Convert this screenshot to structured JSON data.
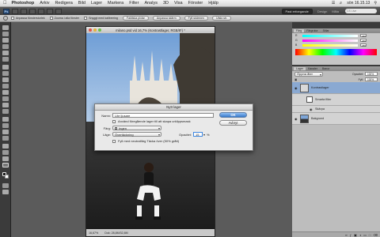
{
  "menubar": {
    "app_name": "Photoshop",
    "items": [
      "Arkiv",
      "Redigera",
      "Bild",
      "Lager",
      "Markera",
      "Filter",
      "Analys",
      "3D",
      "Visa",
      "Fönster",
      "Hjälp"
    ],
    "clock": "sön 16.15.13"
  },
  "appbar": {
    "logo": "Ps",
    "workspace_button": "Past erfoegande",
    "workspace_tabs": [
      "Design",
      "Måla"
    ],
    "search_label": "CS Live"
  },
  "options": {
    "check1": "Anpassa fönsterstorlek",
    "check2": "Zooma i alla fönster",
    "check3": "Snyggt med kalibrering",
    "btn1": "Faktiska pixlar",
    "btn2": "Anpassa skärm",
    "btn3": "Fyll skärmen",
    "btn4": "Utskr.str."
  },
  "document": {
    "title": "milano.psd vid 16,7% (Kontrastlager, RGB/8*) *",
    "zoom": "16,67%",
    "doc_info": "Dok: 28,8M/32,8M"
  },
  "panels": {
    "color_tabs": [
      "Färg",
      "Färgrutor",
      "Stilar"
    ],
    "sliders": [
      {
        "label": "R",
        "value": "255"
      },
      {
        "label": "G",
        "value": "255"
      },
      {
        "label": "B",
        "value": "255"
      }
    ],
    "layers_tabs": [
      "Lager",
      "Kanaler",
      "Banor"
    ],
    "blend_mode": "Öppna åter",
    "opacity_label": "Opacitet:",
    "opacity_value": "100%",
    "fill_label": "Fyll:",
    "fill_value": "100%",
    "layers": [
      {
        "name": "Kontrastlager",
        "selected": true
      },
      {
        "name": "Smarta filter",
        "selected": false
      },
      {
        "name": "Skärpa",
        "selected": false
      },
      {
        "name": "Bakgrund",
        "selected": false
      }
    ]
  },
  "dialog": {
    "title": "Nytt lager",
    "name_label": "Namn:",
    "name_value": "Lite ljusare",
    "use_previous_label": "Använd föregående lager till att skapa urklippsmask",
    "color_label": "Färg:",
    "color_value": "Ingen",
    "mode_label": "Läge:",
    "mode_value": "Övertäckning",
    "opacity_label": "Opacitet:",
    "opacity_value": "15",
    "opacity_unit": "%",
    "fill_neutral_label": "Fyll med neutralfärg Täcka över (50% grått)",
    "ok_label": "OK",
    "cancel_label": "Avbryt"
  },
  "colors": {
    "accent": "#3d86e0",
    "ok_button_top": "#8fbff5",
    "ok_button_bottom": "#3577c9",
    "selected_layer": "#8aa9d2"
  }
}
